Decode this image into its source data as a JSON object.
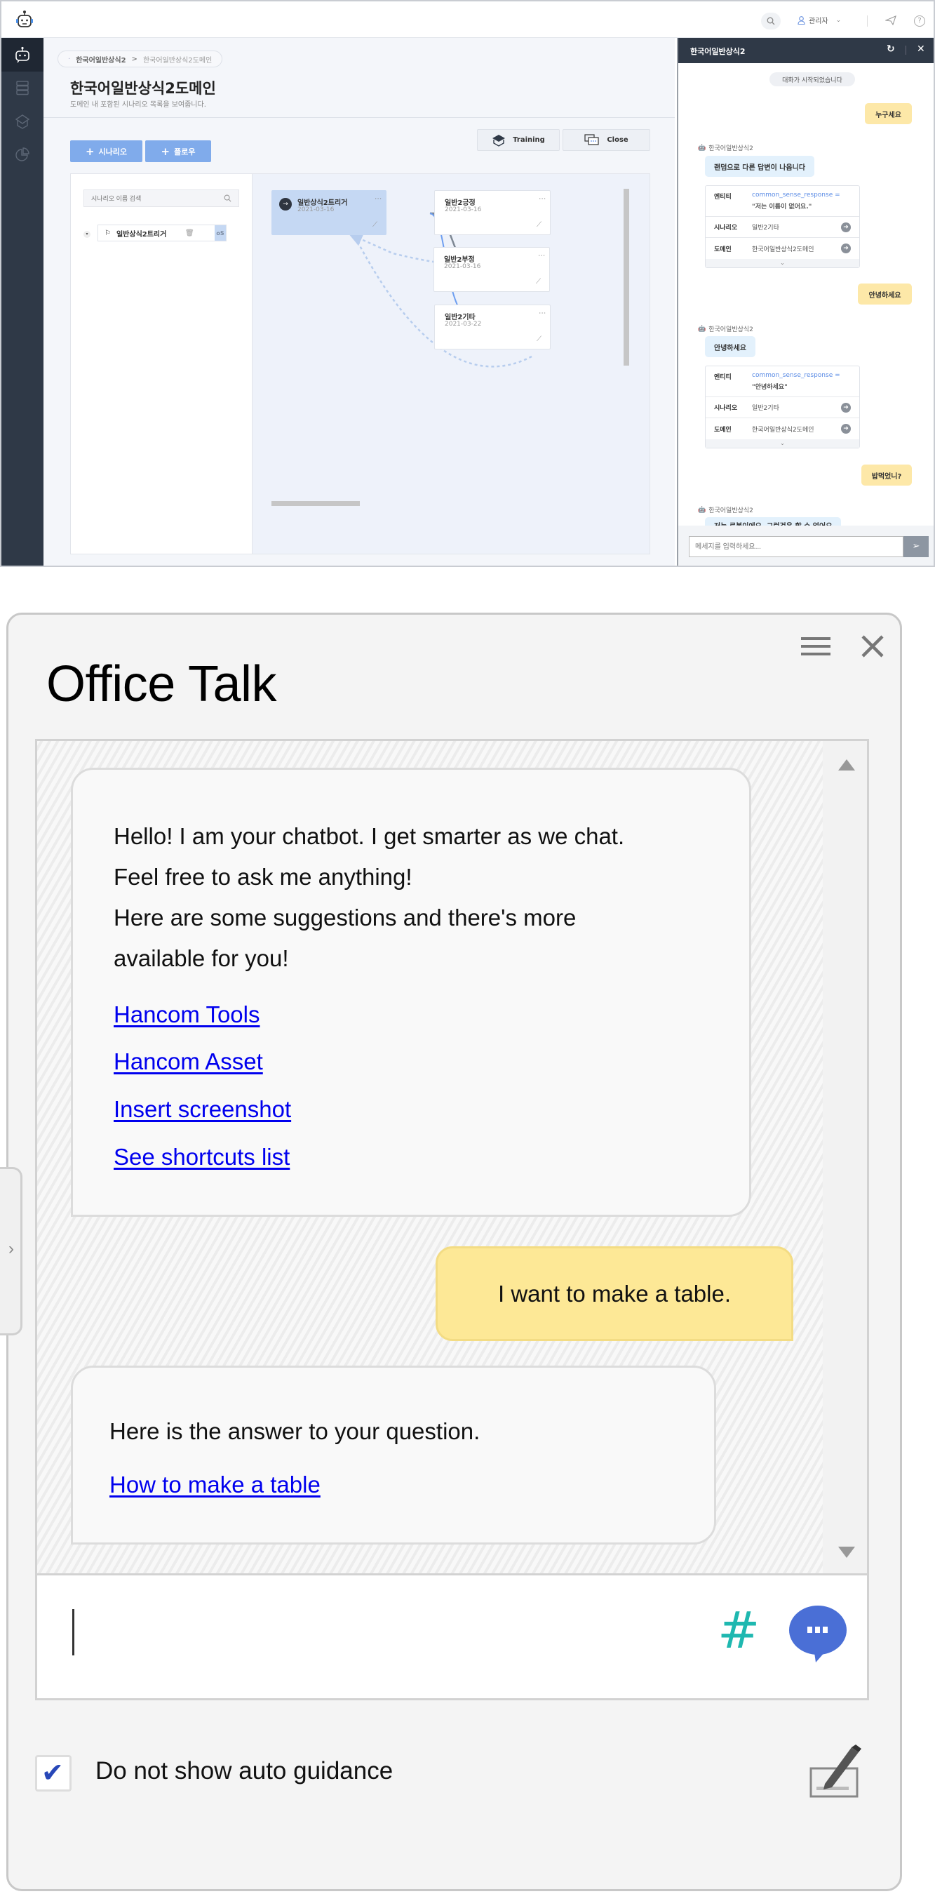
{
  "app": {
    "user_menu": {
      "label": "관리자"
    },
    "breadcrumb": [
      "한국어일반상식2",
      "한국어일반상식2도메인"
    ],
    "page_title": "한국어일반상식2도메인",
    "page_subtitle": "도메인 내 포함된 시나리오 목록을 보여줍니다.",
    "buttons": {
      "add_scenario": "시나리오",
      "add_flow": "플로우",
      "training": "Training",
      "close": "Close"
    },
    "search": {
      "placeholder": "시나리오 이름 검색"
    },
    "tree": [
      {
        "label": "일반상식2트리거"
      }
    ],
    "nodes": [
      {
        "title": "일반상식2트리거",
        "date": "2021-03-16"
      },
      {
        "title": "일반2긍정",
        "date": "2021-03-16"
      },
      {
        "title": "일반2부정",
        "date": "2021-03-16"
      },
      {
        "title": "일반2기타",
        "date": "2021-03-22"
      }
    ],
    "chat": {
      "title": "한국어일반상식2",
      "system_message": "대화가 시작되었습니다",
      "bot_name": "한국어일반상식2",
      "messages": [
        {
          "from": "user",
          "text": "누구세요"
        },
        {
          "from": "bot",
          "text": "랜덤으로 다른 답변이 나옵니다",
          "card": {
            "entity_label": "엔티티",
            "entity": "common_sense_response =",
            "entity_value": "\"저는 이름이 없어요.\"",
            "scenario_label": "시나리오",
            "scenario": "일반2기타",
            "domain_label": "도메인",
            "domain": "한국어일반상식2도메인"
          }
        },
        {
          "from": "user",
          "text": "안녕하세요"
        },
        {
          "from": "bot",
          "text": "안녕하세요",
          "card": {
            "entity_label": "엔티티",
            "entity": "common_sense_response =",
            "entity_value": "\"안녕하세요\"",
            "scenario_label": "시나리오",
            "scenario": "일반2기타",
            "domain_label": "도메인",
            "domain": "한국어일반상식2도메인"
          }
        },
        {
          "from": "user",
          "text": "밥먹었니?"
        },
        {
          "from": "bot",
          "text": "저는 로봇이에요. 그런것은 할 수 없어요"
        }
      ],
      "input_placeholder": "메세지를 입력하세요..."
    }
  },
  "office_talk": {
    "title": "Office Talk",
    "greeting_lines": [
      "Hello! I am your chatbot. I get smarter as we chat.",
      "Feel free to ask me anything!",
      "Here are some suggestions and there's more",
      "available for you!"
    ],
    "suggestions": [
      "Hancom Tools",
      "Hancom Asset",
      "Insert screenshot",
      "See shortcuts list"
    ],
    "user_message": "I want to make a table.",
    "answer_text": "Here is the answer to your question.",
    "answer_link": "How to make a table",
    "input_value": "",
    "auto_guidance_label": "Do not show auto guidance",
    "auto_guidance_checked": true,
    "colors": {
      "link": "#0000ee",
      "user_bubble": "#fde896",
      "hash_icon": "#1fb8b0",
      "chat_icon": "#4a6fd6"
    }
  }
}
